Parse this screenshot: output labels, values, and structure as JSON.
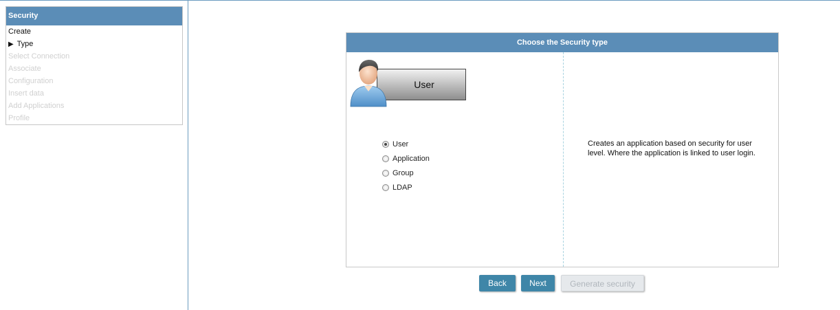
{
  "sidebar": {
    "title": "Security",
    "items": [
      {
        "label": "Create",
        "state": "done"
      },
      {
        "label": "Type",
        "state": "current",
        "marker": "▶"
      },
      {
        "label": "Select Connection",
        "state": "disabled"
      },
      {
        "label": "Associate",
        "state": "disabled"
      },
      {
        "label": "Configuration",
        "state": "disabled"
      },
      {
        "label": "Insert data",
        "state": "disabled"
      },
      {
        "label": "Add Applications",
        "state": "disabled"
      },
      {
        "label": "Profile",
        "state": "disabled"
      }
    ]
  },
  "panel": {
    "title": "Choose the Security type",
    "selected_type_label": "User",
    "options": [
      {
        "label": "User",
        "checked": true
      },
      {
        "label": "Application",
        "checked": false
      },
      {
        "label": "Group",
        "checked": false
      },
      {
        "label": "LDAP",
        "checked": false
      }
    ],
    "description": "Creates an application based on security for user level. Where the application is linked to user login."
  },
  "buttons": {
    "back": "Back",
    "next": "Next",
    "generate": "Generate security"
  },
  "colors": {
    "header": "#5b8db7",
    "button": "#3f86a8",
    "disabled_text": "#d0d0d0"
  }
}
